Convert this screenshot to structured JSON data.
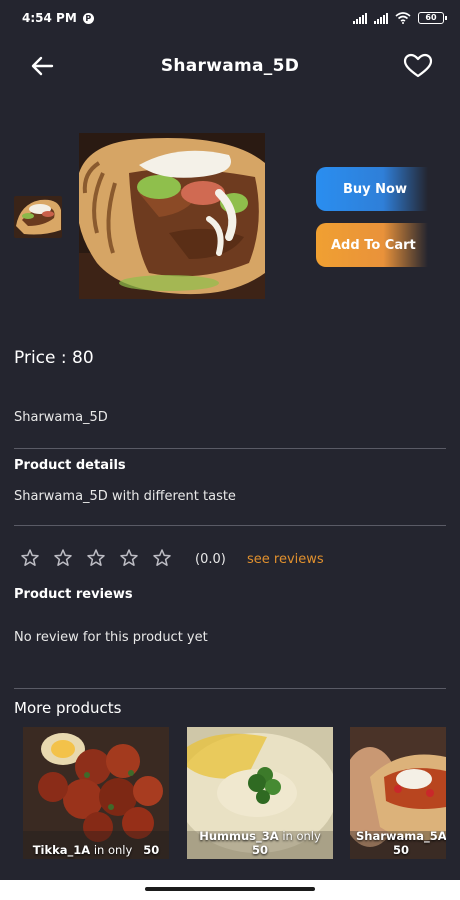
{
  "status_bar": {
    "time": "4:54 PM",
    "notification_badge": "P",
    "battery": "60"
  },
  "header": {
    "title": "Sharwama_5D",
    "back_icon": "arrow-left-icon",
    "favorite_icon": "heart-outline-icon"
  },
  "actions": {
    "buy_now": "Buy Now",
    "add_to_cart": "Add To Cart"
  },
  "product": {
    "price": "Price : 80",
    "name": "Sharwama_5D",
    "details_title": "Product details",
    "details_text": "Sharwama_5D with different taste",
    "rating_stars": 0,
    "rating_value": "(0.0)",
    "see_reviews": "see reviews",
    "reviews_title": "Product reviews",
    "no_review": "No review for this product yet"
  },
  "more_products": {
    "title": "More products",
    "items": [
      {
        "name": "Tikka_1A",
        "suffix": "in only",
        "price": "50"
      },
      {
        "name": "Hummus_3A",
        "suffix": "in only",
        "price": "50"
      },
      {
        "name": "Sharwama_5A",
        "suffix": "",
        "price": "50"
      }
    ]
  },
  "colors": {
    "background": "#24252f",
    "buy_now": "#2a8ef0",
    "add_to_cart": "#f0a032",
    "see_reviews": "#e0902e"
  }
}
